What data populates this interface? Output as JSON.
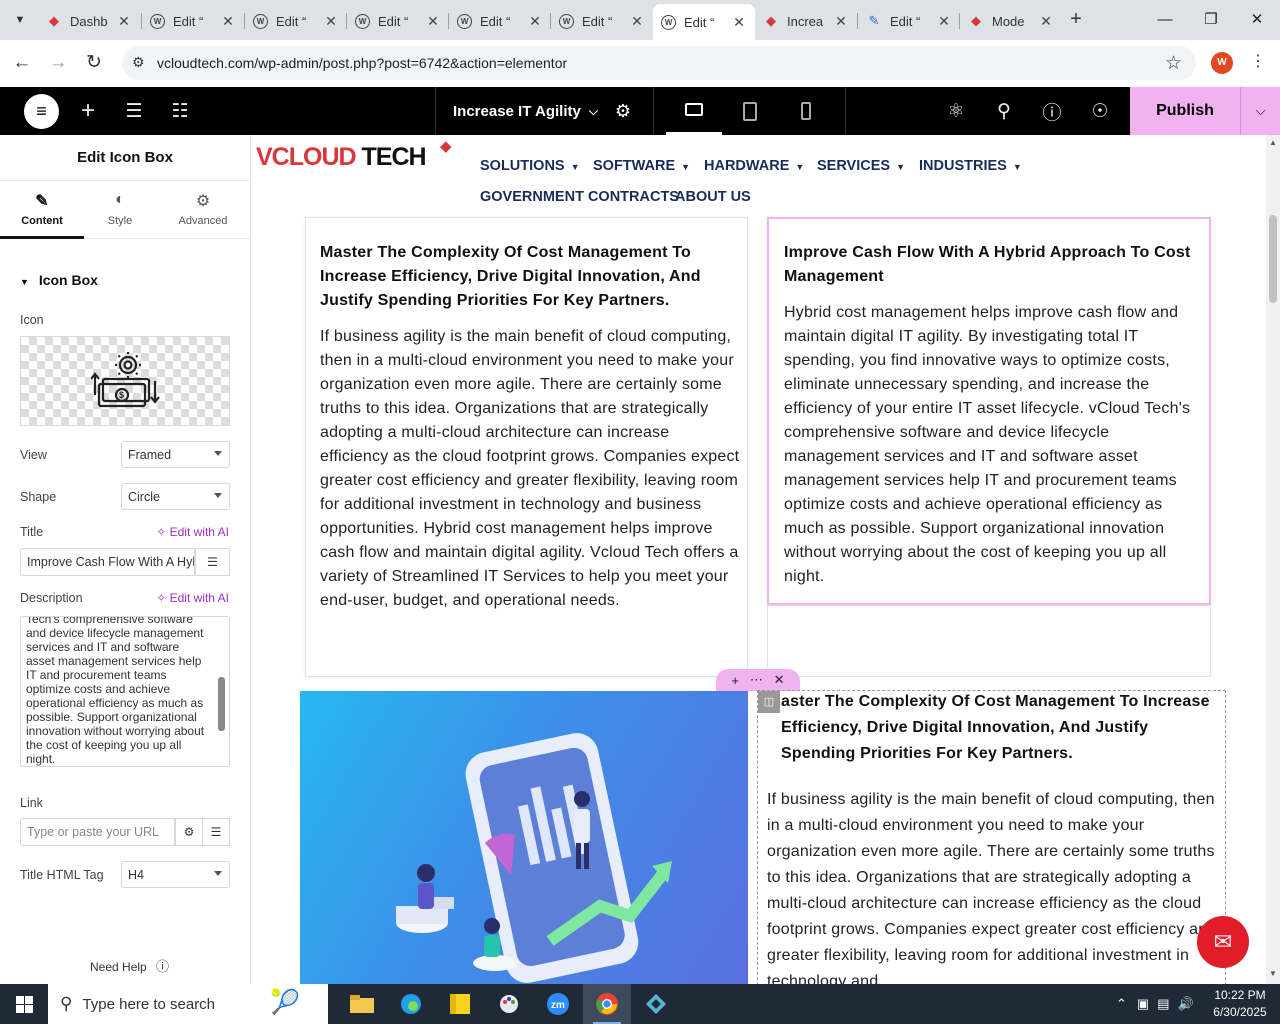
{
  "browser": {
    "tabs": [
      {
        "title": "Dashb",
        "icon": "gem-icon"
      },
      {
        "title": "Edit “",
        "icon": "wordpress-icon"
      },
      {
        "title": "Edit “",
        "icon": "wordpress-icon"
      },
      {
        "title": "Edit “",
        "icon": "wordpress-icon"
      },
      {
        "title": "Edit “",
        "icon": "wordpress-icon"
      },
      {
        "title": "Edit “",
        "icon": "wordpress-icon"
      },
      {
        "title": "Edit “",
        "icon": "wordpress-icon"
      },
      {
        "title": "Increa",
        "icon": "gem-icon"
      },
      {
        "title": "Edit “",
        "icon": "wpforms-icon"
      },
      {
        "title": "Mode",
        "icon": "gem-icon"
      }
    ],
    "active_tab": 6,
    "url": "vcloudtech.com/wp-admin/post.php?post=6742&action=elementor",
    "profile_initial": "W"
  },
  "elementor": {
    "document_title": "Increase IT Agility",
    "publish_label": "Publish",
    "panel": {
      "title": "Edit Icon Box",
      "tabs": [
        "Content",
        "Style",
        "Advanced"
      ],
      "section": "Icon Box",
      "icon_label": "Icon",
      "view_label": "View",
      "view_value": "Framed",
      "shape_label": "Shape",
      "shape_value": "Circle",
      "title_label": "Title",
      "edit_ai": "Edit with AI",
      "title_value": "Improve Cash Flow With A Hybrid Approach To Cost Management",
      "description_label": "Description",
      "description_value": "Tech's comprehensive software and device lifecycle management services and IT and software asset management services help IT and procurement teams optimize costs and achieve operational efficiency as much as possible. Support organizational innovation without worrying about the cost of keeping you up all night.",
      "link_label": "Link",
      "link_placeholder": "Type or paste your URL",
      "html_tag_label": "Title HTML Tag",
      "html_tag_value": "H4",
      "need_help": "Need Help"
    }
  },
  "site": {
    "logo_v": "VCLOUD",
    "logo_rest": "TECH",
    "nav": [
      "SOLUTIONS",
      "SOFTWARE",
      "HARDWARE",
      "SERVICES",
      "INDUSTRIES",
      "GOVERNMENT CONTRACTS",
      "ABOUT US"
    ],
    "card_left": {
      "title": "Master The Complexity Of Cost Management To Increase Efficiency, Drive Digital Innovation, And Justify Spending Priorities For Key Partners.",
      "text": "If business agility is the main benefit of cloud computing, then in a multi-cloud environment you need to make your organization even more agile. There are certainly some truths to this idea. Organizations that are strategically adopting a multi-cloud architecture can increase efficiency as the cloud footprint grows. Companies expect greater cost efficiency and greater flexibility, leaving room for additional investment in technology and business opportunities. Hybrid cost management helps improve cash flow and maintain digital agility. Vcloud Tech offers a variety of Streamlined IT Services to help you meet your end-user, budget, and operational needs."
    },
    "card_right": {
      "title": "Improve Cash Flow With A Hybrid Approach To Cost Management",
      "text": "Hybrid cost management helps improve cash flow and maintain digital IT agility. By investigating total IT spending, you find innovative ways to optimize costs, eliminate unnecessary spending, and increase the efficiency of your entire IT asset lifecycle. vCloud Tech's comprehensive software and device lifecycle management services and IT and software asset management services help IT and procurement teams optimize costs and achieve operational efficiency as much as possible. Support organizational innovation without worrying about the cost of keeping you up all night."
    },
    "lower_block": {
      "title": "aster The Complexity Of Cost Management To Increase Efficiency, Drive Digital Innovation, And Justify Spending Priorities For Key Partners.",
      "text": "If business agility is the main benefit of cloud computing, then in a multi-cloud environment you need to make your organization even more agile. There are certainly some truths to this idea. Organizations that are strategically adopting a multi-cloud architecture can increase efficiency as the cloud footprint grows. Companies expect greater cost efficiency and greater flexibility, leaving room for additional investment in technology and"
    }
  },
  "taskbar": {
    "search_placeholder": "Type here to search",
    "time": "10:22 PM",
    "date": "6/30/2025"
  },
  "colors": {
    "brand_red": "#d9363e",
    "publish_pink": "#f0b3ef",
    "nav_navy": "#1a2d5a"
  }
}
